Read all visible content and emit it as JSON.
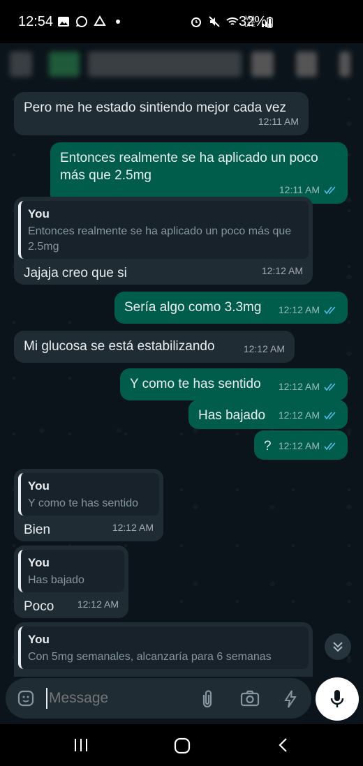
{
  "status_bar": {
    "time": "12:54",
    "battery_percent": "32%",
    "net_label_top": "Vo)",
    "net_label_bottom": "LTE"
  },
  "messages": [
    {
      "direction": "in",
      "text": "Pero me he estado sintiendo mejor cada vez",
      "time": "12:11 AM"
    },
    {
      "direction": "out",
      "text": "Entonces realmente se ha aplicado un poco más que 2.5mg",
      "time": "12:11 AM"
    },
    {
      "direction": "in",
      "quote_author": "You",
      "quote_text": "Entonces realmente se ha aplicado un poco más que 2.5mg",
      "text": "Jajaja creo que si",
      "time": "12:12 AM"
    },
    {
      "direction": "out",
      "text": "Sería algo como 3.3mg",
      "time": "12:12 AM"
    },
    {
      "direction": "in",
      "text": "Mi glucosa se está estabilizando",
      "time": "12:12 AM"
    },
    {
      "direction": "out",
      "text": "Y como te has sentido",
      "time": "12:12 AM"
    },
    {
      "direction": "out",
      "text": "Has bajado",
      "time": "12:12 AM"
    },
    {
      "direction": "out",
      "text": "?",
      "time": "12:12 AM"
    },
    {
      "direction": "in",
      "quote_author": "You",
      "quote_text": "Y como te has sentido",
      "text": "Bien",
      "time": "12:12 AM"
    },
    {
      "direction": "in",
      "quote_author": "You",
      "quote_text": "Has bajado",
      "text": "Poco",
      "time": "12:12 AM"
    },
    {
      "direction": "in",
      "quote_author": "You",
      "quote_text": "Con 5mg semanales, alcanzaría para 6 semanas",
      "text": "",
      "time": ""
    }
  ],
  "composer": {
    "placeholder": "Message"
  },
  "colors": {
    "incoming_bubble": "#1f2c34",
    "outgoing_bubble": "#005c4b",
    "read_ticks": "#53bdeb",
    "background": "#0b141a"
  }
}
